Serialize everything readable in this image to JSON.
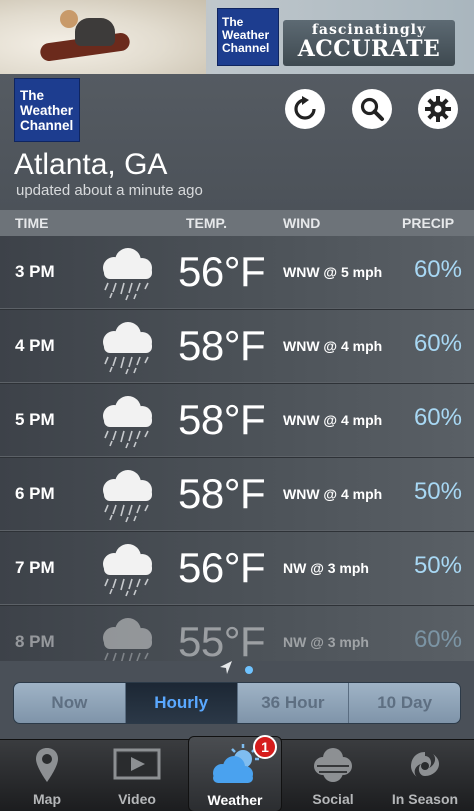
{
  "ad": {
    "logo_line1": "The",
    "logo_line2": "Weather",
    "logo_line3": "Channel",
    "slogan_line1": "fascinatingly",
    "slogan_line2": "ACCURATE"
  },
  "header": {
    "logo_line1": "The",
    "logo_line2": "Weather",
    "logo_line3": "Channel",
    "city": "Atlanta, GA",
    "updated": "updated about a minute ago",
    "icons": [
      "refresh-icon",
      "search-icon",
      "gear-icon"
    ]
  },
  "columns": {
    "time": "TIME",
    "temp": "TEMP.",
    "wind": "WIND",
    "precip": "PRECIP"
  },
  "rows": [
    {
      "time": "3 PM",
      "icon": "rain-cloud-icon",
      "temp": "56°F",
      "wind": "WNW @ 5 mph",
      "precip": "60%"
    },
    {
      "time": "4 PM",
      "icon": "rain-cloud-icon",
      "temp": "58°F",
      "wind": "WNW @ 4 mph",
      "precip": "60%"
    },
    {
      "time": "5 PM",
      "icon": "rain-cloud-icon",
      "temp": "58°F",
      "wind": "WNW @ 4 mph",
      "precip": "60%"
    },
    {
      "time": "6 PM",
      "icon": "rain-cloud-icon",
      "temp": "58°F",
      "wind": "WNW @ 4 mph",
      "precip": "50%"
    },
    {
      "time": "7 PM",
      "icon": "rain-cloud-icon",
      "temp": "56°F",
      "wind": "NW @ 3 mph",
      "precip": "50%"
    },
    {
      "time": "8 PM",
      "icon": "rain-cloud-icon",
      "temp": "55°F",
      "wind": "NW @ 3 mph",
      "precip": "60%"
    }
  ],
  "segments": {
    "now": "Now",
    "hourly": "Hourly",
    "h36": "36 Hour",
    "d10": "10 Day",
    "active": "Hourly"
  },
  "tabs": {
    "map": "Map",
    "video": "Video",
    "weather": "Weather",
    "weather_badge": "1",
    "social": "Social",
    "in_season": "In Season",
    "active": "Weather"
  },
  "colors": {
    "precip": "#a8d8f4",
    "accent": "#5aa8ff",
    "logo_blue": "#1d3d8f",
    "badge_red": "#d61c1c"
  }
}
